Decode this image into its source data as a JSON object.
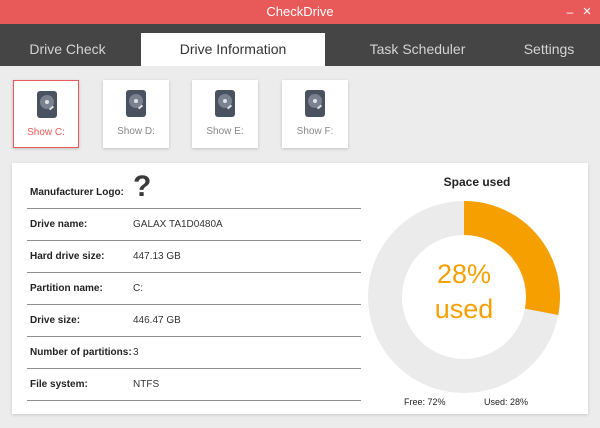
{
  "window": {
    "title": "CheckDrive",
    "minimize": "–",
    "close": "×"
  },
  "tabs": [
    {
      "label": "Drive Check"
    },
    {
      "label": "Drive Information"
    },
    {
      "label": "Task Scheduler"
    },
    {
      "label": "Settings"
    }
  ],
  "drives": [
    {
      "label": "Show C:",
      "icon": "hard-drive-icon",
      "selected": true
    },
    {
      "label": "Show D:",
      "icon": "hard-drive-icon",
      "selected": false
    },
    {
      "label": "Show E:",
      "icon": "hard-drive-icon",
      "selected": false
    },
    {
      "label": "Show F:",
      "icon": "hard-drive-icon",
      "selected": false
    }
  ],
  "info": {
    "manufacturer_label": "Manufacturer Logo:",
    "manufacturer_logo": "?",
    "rows": [
      {
        "label": "Drive name:",
        "value": "GALAX TA1D0480A"
      },
      {
        "label": "Hard drive size:",
        "value": "447.13 GB"
      },
      {
        "label": "Partition name:",
        "value": "C:"
      },
      {
        "label": "Drive size:",
        "value": "446.47 GB"
      },
      {
        "label": "Number of partitions:",
        "value": "3"
      },
      {
        "label": "File system:",
        "value": "NTFS"
      }
    ]
  },
  "space": {
    "title": "Space used",
    "used_percent": 28,
    "percent_text": "28%",
    "used_word": "used",
    "free_label": "Free: 72%",
    "used_label": "Used: 28%"
  },
  "colors": {
    "accent": "#e8595a",
    "tab_bar": "#454545",
    "used": "#f5a000",
    "free": "#ebebeb"
  }
}
